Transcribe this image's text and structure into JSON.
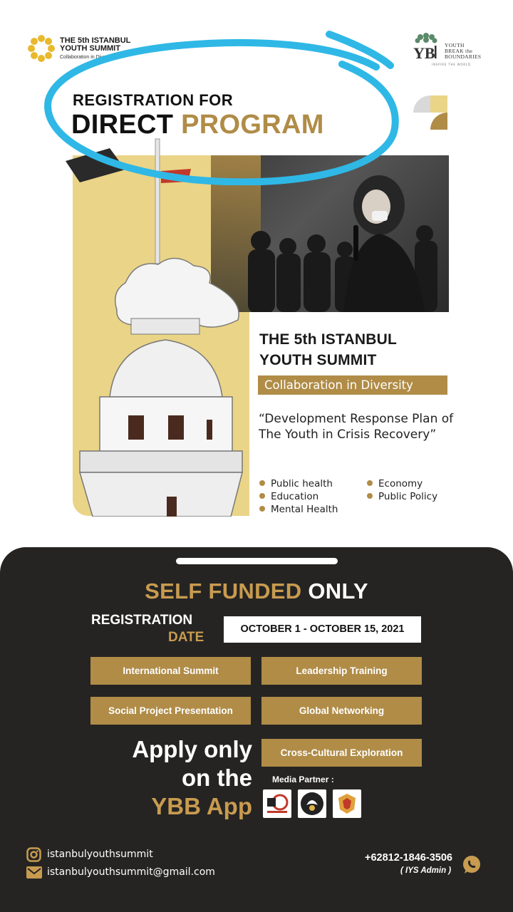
{
  "colors": {
    "gold": "#b08c47",
    "gold_light": "#c89b4f",
    "panel_yellow": "#ead487",
    "dark_bg": "#252423",
    "annotation_blue": "#2fb8e6"
  },
  "header": {
    "summit_logo": {
      "line1": "THE 5th ISTANBUL",
      "line2": "YOUTH SUMMIT",
      "line3": "Collaboration in Diversity"
    },
    "ybb_logo": {
      "mark": "YB",
      "line1": "YOUTH",
      "line2": "BREAK the",
      "line3": "BOUNDARIES",
      "tagline": "INSPIRE THE WORLD"
    }
  },
  "headline": {
    "line1": "REGISTRATION FOR",
    "line2_dark": "DIRECT",
    "line2_gold": "PROGRAM"
  },
  "summit": {
    "title_line1": "THE 5th ISTANBUL",
    "title_line2": "YOUTH SUMMIT",
    "theme": "Collaboration in Diversity",
    "quote": "“Development Response Plan of The Youth in Crisis Recovery”",
    "topics": [
      "Public health",
      "Education",
      "Mental Health",
      "Economy",
      "Public Policy"
    ]
  },
  "registration": {
    "funding_gold": "SELF FUNDED",
    "funding_white": "ONLY",
    "label_line1": "REGISTRATION",
    "label_line2": "DATE",
    "dates": "OCTOBER 1 - OCTOBER 15, 2021"
  },
  "programs": [
    "International Summit",
    "Leadership Training",
    "Social Project Presentation",
    "Global Networking",
    "Cross-Cultural Exploration"
  ],
  "apply": {
    "line1": "Apply only",
    "line2": "on the",
    "line3": "YBB App"
  },
  "media_partner_label": "Media Partner :",
  "contacts": {
    "instagram": "istanbulyouthsummit",
    "email": "istanbulyouthsummit@gmail.com",
    "phone": "+62812-1846-3506",
    "admin": "( IYS Admin )"
  }
}
